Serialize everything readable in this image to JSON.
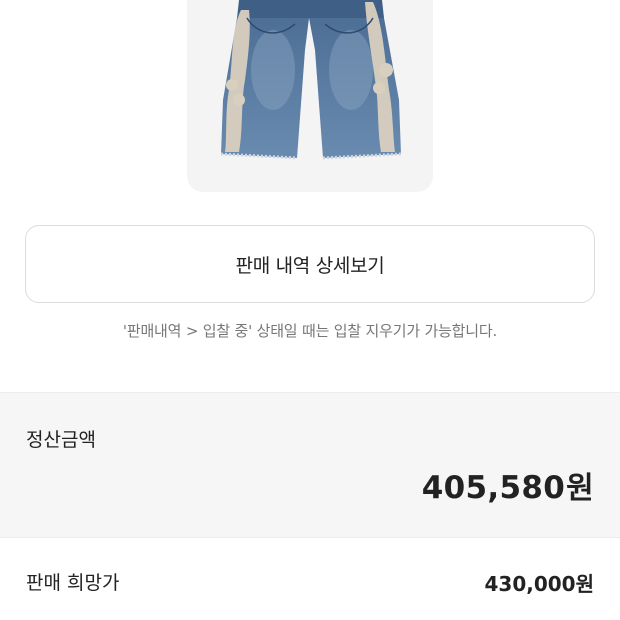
{
  "product": {
    "image_alt": "denim shorts with bone pattern"
  },
  "detail_button": {
    "label": "판매 내역 상세보기"
  },
  "notice": {
    "text": "'판매내역 > 입찰 중' 상태일 때는 입찰 지우기가 가능합니다."
  },
  "settlement": {
    "label": "정산금액",
    "amount": "405,580",
    "unit": "원"
  },
  "asking_price": {
    "label": "판매 희망가",
    "amount": "430,000",
    "unit": "원"
  }
}
